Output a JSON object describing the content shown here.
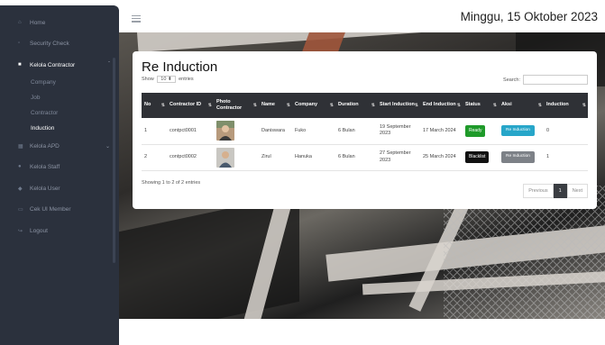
{
  "sidebar": {
    "items": [
      {
        "label": "Home",
        "icon": "home-icon"
      },
      {
        "label": "Security Check",
        "icon": "shield-icon"
      },
      {
        "label": "Kelola Contractor",
        "icon": "folder-icon"
      },
      {
        "label": "Kelola APD",
        "icon": "grid-icon"
      },
      {
        "label": "Kelola Staff",
        "icon": "user-icon"
      },
      {
        "label": "Kelola User",
        "icon": "users-icon"
      },
      {
        "label": "Cek UI Member",
        "icon": "monitor-icon"
      },
      {
        "label": "Logout",
        "icon": "logout-icon"
      }
    ],
    "subitems": [
      "Company",
      "Job",
      "Contractor",
      "Induction"
    ]
  },
  "header": {
    "date": "Minggu, 15 Oktober 2023"
  },
  "page": {
    "title": "Re Induction",
    "show_prefix": "Show",
    "show_value": "10",
    "show_suffix": "entries",
    "search_label": "Search:",
    "search_value": ""
  },
  "table": {
    "columns": [
      "No",
      "Contractor ID",
      "Photo Contractor",
      "Name",
      "Company",
      "Duration",
      "Start Induction",
      "End Induction",
      "Status",
      "Aksi",
      "Induction"
    ],
    "rows": [
      {
        "no": "1",
        "contractor_id": "contpct0001",
        "name": "Daniswara",
        "company": "Fuko",
        "duration": "6 Bulan",
        "start": "19 September 2023",
        "end": "17 March 2024",
        "status": "Ready",
        "status_color": "#1f9a2a",
        "aksi": "Re Induction",
        "aksi_color": "#27a6c9",
        "induction": "0"
      },
      {
        "no": "2",
        "contractor_id": "contpct0002",
        "name": "Zirul",
        "company": "Hanuka",
        "duration": "6 Bulan",
        "start": "27 September 2023",
        "end": "25 March 2024",
        "status": "Blacklist",
        "status_color": "#111111",
        "aksi": "Re Induction",
        "aksi_color": "#7d8187",
        "induction": "1"
      }
    ]
  },
  "footer": {
    "info": "Showing 1 to 2 of 2 entries",
    "prev": "Previous",
    "page": "1",
    "next": "Next"
  }
}
